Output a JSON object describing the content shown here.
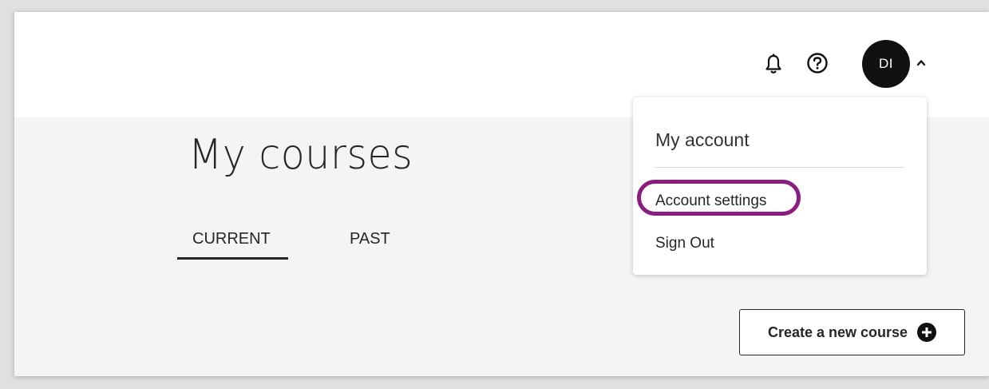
{
  "header": {
    "notifications_icon": "bell-icon",
    "help_icon": "help-circle-icon",
    "avatar_initials": "DI",
    "menu_toggle_icon": "chevron-up-icon"
  },
  "main": {
    "title": "My courses",
    "tabs": [
      {
        "label": "CURRENT",
        "selected": true
      },
      {
        "label": "PAST",
        "selected": false
      }
    ],
    "create_button": {
      "label": "Create a new course",
      "icon": "plus-circle-icon"
    }
  },
  "account_menu": {
    "heading": "My account",
    "items": [
      {
        "label": "Account settings",
        "highlighted": true
      },
      {
        "label": "Sign Out",
        "highlighted": false
      }
    ],
    "highlight_color": "#8a1d7e"
  }
}
